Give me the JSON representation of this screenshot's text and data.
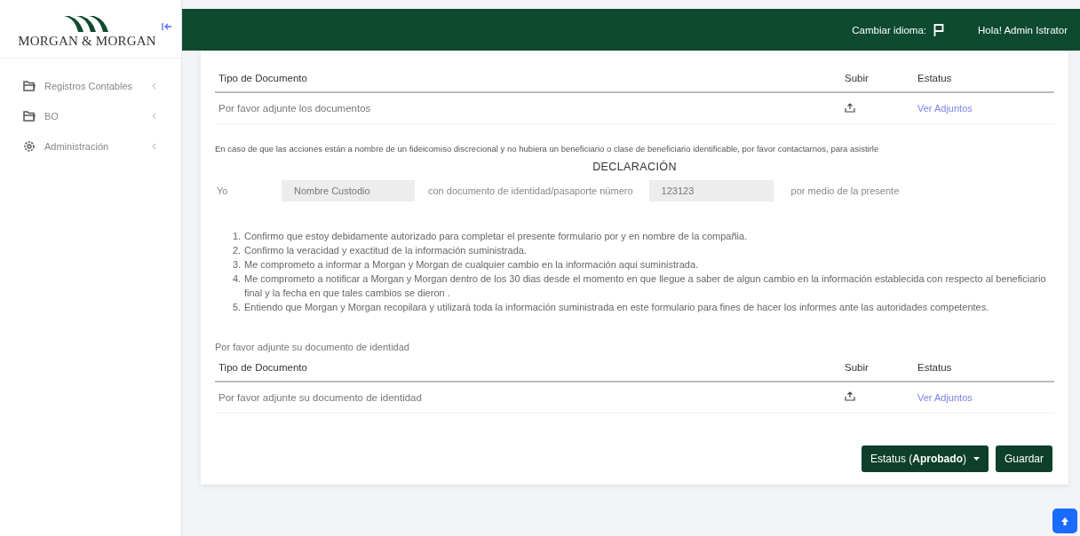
{
  "sidebar": {
    "logo_text": "MORGAN & MORGAN",
    "items": [
      {
        "label": "Registros Contables",
        "kind": "folder"
      },
      {
        "label": "BO",
        "kind": "folder"
      },
      {
        "label": "Administración",
        "kind": "gear"
      }
    ]
  },
  "header": {
    "language_label": "Cambiar idioma:",
    "greeting": "Hola! Admin Istrator"
  },
  "documents_table": {
    "columns": [
      "Tipo de Documento",
      "Subir",
      "Estatus"
    ],
    "rows": [
      {
        "document": "Por favor adjunte los documentos",
        "status_link": "Ver Adjuntos"
      }
    ]
  },
  "notice": "En caso de que las acciones están a nombre de un fideicomiso discrecional y no hubiera un beneficiario o clase de beneficiario identificable, por favor contactarnos, para asistirle",
  "declaration": {
    "title": "DECLARACIÓN",
    "prefix": "Yo",
    "name_value": "Nombre Custodio",
    "middle_text": "con documento de identidad/pasaporte número",
    "id_value": "123123",
    "suffix": "por medio de la presente",
    "statements": [
      {
        "number": "1.",
        "text": "Confirmo que estoy debidamente autorizado para completar el presente formulario por y en nombre de la compañia."
      },
      {
        "number": "2.",
        "text": "Confirmo la veracidad y exactitud de la información suministrada."
      },
      {
        "number": "3.",
        "text": "Me comprometo a informar a Morgan y Morgan de cualquier cambio en la información aqui suministrada."
      },
      {
        "number": "4.",
        "text": "Me comprometo a notificar a Morgan y Morgan dentro de los 30 dias desde el momento en que llegue a saber de algun cambio en la información establecida con respecto al beneficiario final y la fecha en que tales cambios se dieron ."
      },
      {
        "number": "5.",
        "text": "Entiendo que Morgan y Morgan recopilara y utilizará toda la información suministrada en este formulario para fines de hacer los informes ante las autoridades competentes."
      }
    ]
  },
  "identity_prompt": "Por favor adjunte su documento de identidad",
  "identity_table": {
    "columns": [
      "Tipo de Documento",
      "Subir",
      "Estatus"
    ],
    "rows": [
      {
        "document": "Por favor adjunte su documento de identidad",
        "status_link": "Ver Adjuntos"
      }
    ]
  },
  "actions": {
    "status_button": "Estatus (**Aprobado**)",
    "save_button": "Guardar"
  }
}
